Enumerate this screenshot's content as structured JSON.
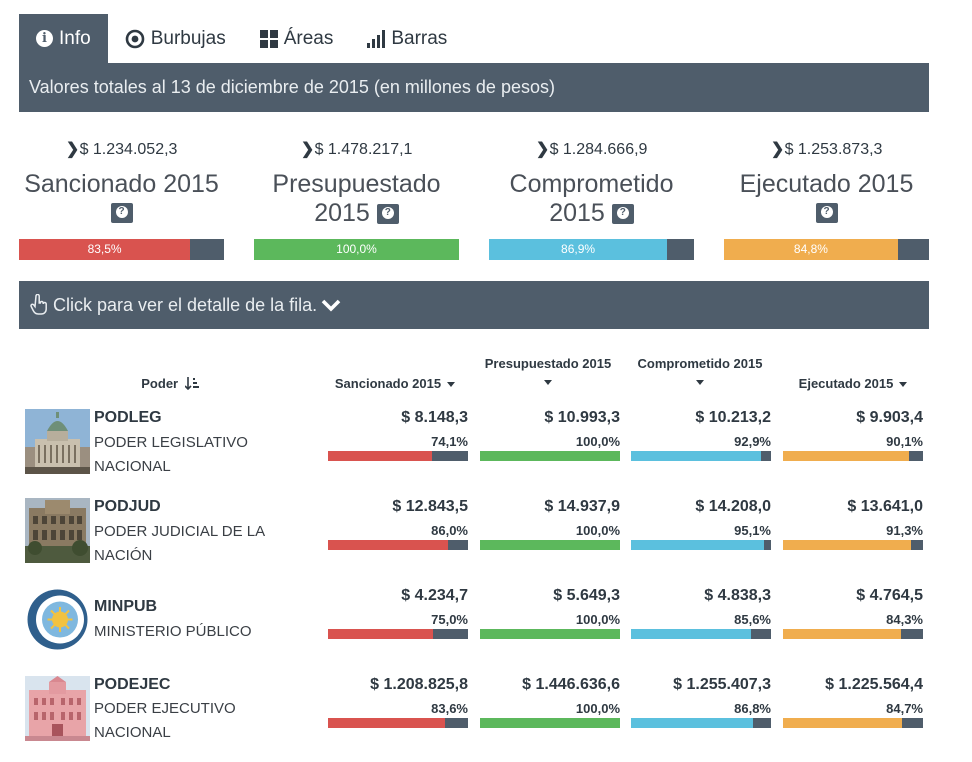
{
  "tabs": [
    {
      "label": "Info",
      "icon": "info-icon",
      "active": true
    },
    {
      "label": "Burbujas",
      "icon": "bubble-icon",
      "active": false
    },
    {
      "label": "Áreas",
      "icon": "grid-icon",
      "active": false
    },
    {
      "label": "Barras",
      "icon": "bar-chart-icon",
      "active": false
    }
  ],
  "totals_title": "Valores totales al 13 de diciembre de 2015 (en millones de pesos)",
  "colors": {
    "dark": "#4f5d6b",
    "sancionado": "#d9534f",
    "presupuestado": "#5cb85c",
    "comprometido": "#5bc0de",
    "ejecutado": "#f0ad4e"
  },
  "summary": [
    {
      "amount": "$ 1.234.052,3",
      "line1": "Sancionado 2015",
      "line2": "",
      "pct_label": "83,5%",
      "pct": 83.5
    },
    {
      "amount": "$ 1.478.217,1",
      "line1": "Presupuestado",
      "line2": "2015",
      "pct_label": "100,0%",
      "pct": 100
    },
    {
      "amount": "$ 1.284.666,9",
      "line1": "Comprometido",
      "line2": "2015",
      "pct_label": "86,9%",
      "pct": 86.9
    },
    {
      "amount": "$ 1.253.873,3",
      "line1": "Ejecutado 2015",
      "line2": "",
      "pct_label": "84,8%",
      "pct": 84.8
    }
  ],
  "click_bar_label": "Click para ver el detalle de la fila.",
  "columns": {
    "poder": "Poder",
    "sancionado": "Sancionado 2015",
    "presupuestado": "Presupuestado 2015",
    "comprometido": "Comprometido 2015",
    "ejecutado": "Ejecutado 2015"
  },
  "rows": [
    {
      "code": "PODLEG",
      "name": "PODER LEGISLATIVO NACIONAL",
      "image": "congress-building",
      "cells": [
        {
          "value": "$ 8.148,3",
          "pct_label": "74,1%",
          "pct": 74.1
        },
        {
          "value": "$ 10.993,3",
          "pct_label": "100,0%",
          "pct": 100
        },
        {
          "value": "$ 10.213,2",
          "pct_label": "92,9%",
          "pct": 92.9
        },
        {
          "value": "$ 9.903,4",
          "pct_label": "90,1%",
          "pct": 90.1
        }
      ]
    },
    {
      "code": "PODJUD",
      "name": "PODER JUDICIAL DE LA NACIÓN",
      "image": "courthouse-building",
      "cells": [
        {
          "value": "$ 12.843,5",
          "pct_label": "86,0%",
          "pct": 86.0
        },
        {
          "value": "$ 14.937,9",
          "pct_label": "100,0%",
          "pct": 100
        },
        {
          "value": "$ 14.208,0",
          "pct_label": "95,1%",
          "pct": 95.1
        },
        {
          "value": "$ 13.641,0",
          "pct_label": "91,3%",
          "pct": 91.3
        }
      ]
    },
    {
      "code": "MINPUB",
      "name": "MINISTERIO PÚBLICO",
      "image": "ministerio-publico-logo",
      "cells": [
        {
          "value": "$ 4.234,7",
          "pct_label": "75,0%",
          "pct": 75.0
        },
        {
          "value": "$ 5.649,3",
          "pct_label": "100,0%",
          "pct": 100
        },
        {
          "value": "$ 4.838,3",
          "pct_label": "85,6%",
          "pct": 85.6
        },
        {
          "value": "$ 4.764,5",
          "pct_label": "84,3%",
          "pct": 84.3
        }
      ]
    },
    {
      "code": "PODEJEC",
      "name": "PODER EJECUTIVO NACIONAL",
      "image": "casa-rosada-building",
      "cells": [
        {
          "value": "$ 1.208.825,8",
          "pct_label": "83,6%",
          "pct": 83.6
        },
        {
          "value": "$ 1.446.636,6",
          "pct_label": "100,0%",
          "pct": 100
        },
        {
          "value": "$ 1.255.407,3",
          "pct_label": "86,8%",
          "pct": 86.8
        },
        {
          "value": "$ 1.225.564,4",
          "pct_label": "84,7%",
          "pct": 84.7
        }
      ]
    }
  ]
}
